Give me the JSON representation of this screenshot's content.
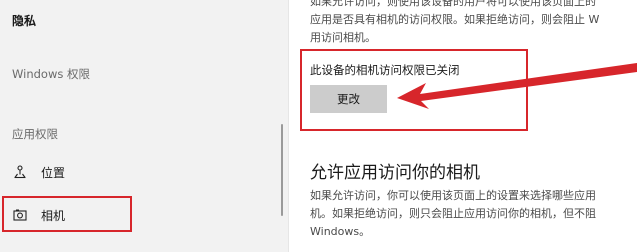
{
  "sidebar": {
    "title": "隐私",
    "windows_section": "Windows 权限",
    "app_section": "应用权限",
    "items": [
      {
        "label": "位置",
        "icon": "location-icon"
      },
      {
        "label": "相机",
        "icon": "camera-icon",
        "selected": true
      }
    ]
  },
  "main": {
    "intro_lines": [
      "如果允许访问，则使用该设备的用户将可以使用该页面上的",
      "应用是否具有相机的访问权限。如果拒绝访问，则会阻止 W",
      "用访问相机。"
    ],
    "device_status": "此设备的相机访问权限已关闭",
    "change_button": "更改",
    "heading": "允许应用访问你的相机",
    "desc_lines": [
      "如果允许访问，你可以使用该页面上的设置来选择哪些应用",
      "机。如果拒绝访问，则只会阻止应用访问你的相机，但不阻",
      "Windows。"
    ]
  },
  "colors": {
    "highlight": "#d7262b",
    "sidebar_bg": "#f2f2f2",
    "button_bg": "#cccccc"
  }
}
